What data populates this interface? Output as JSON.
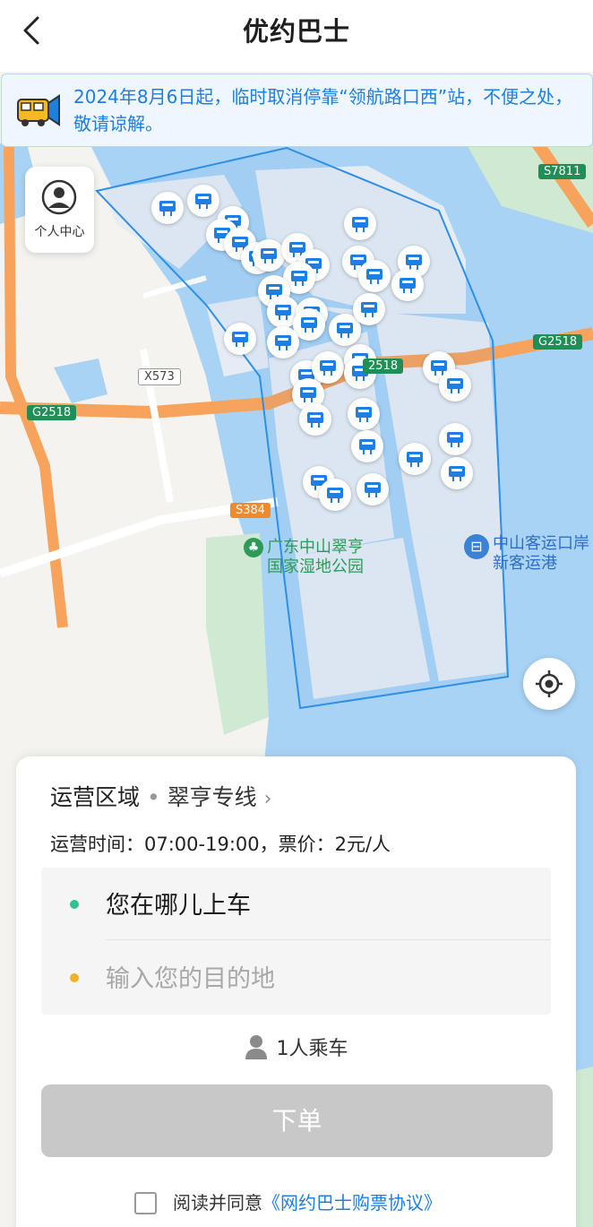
{
  "header": {
    "title": "优约巴士"
  },
  "notice": {
    "text": "2024年8月6日起，临时取消停靠“领航路口西”站，不便之处，敬请谅解。"
  },
  "personal_center": {
    "label": "个人中心"
  },
  "map": {
    "labels": {
      "park": "广东中山翠亨\n国家湿地公园",
      "bus_port": "中山客运口岸\n新客运港"
    },
    "road_tags": {
      "s7811": "S7811",
      "g2518_right": "G2518",
      "g2518_left": "G2518",
      "g2518_mid": "2518",
      "x573": "X573",
      "s384": "S384"
    },
    "colors": {
      "water": "#a9d3f5",
      "land": "#f4f3ef",
      "island": "#e6ecf3",
      "highway": "#f7a35c",
      "boundary": "#2e8fe6",
      "green": "#cfe9d3"
    }
  },
  "panel": {
    "area_label": "运营区域",
    "route_name": "翠亨专线",
    "hours": "运营时间：07:00-19:00，票价：2元/人",
    "from_placeholder": "您在哪儿上车",
    "to_placeholder": "输入您的目的地",
    "passengers": "1人乘车",
    "order_button": "下单",
    "agree_text": "阅读并同意",
    "agreement_link": "《网约巴士购票协议》"
  }
}
